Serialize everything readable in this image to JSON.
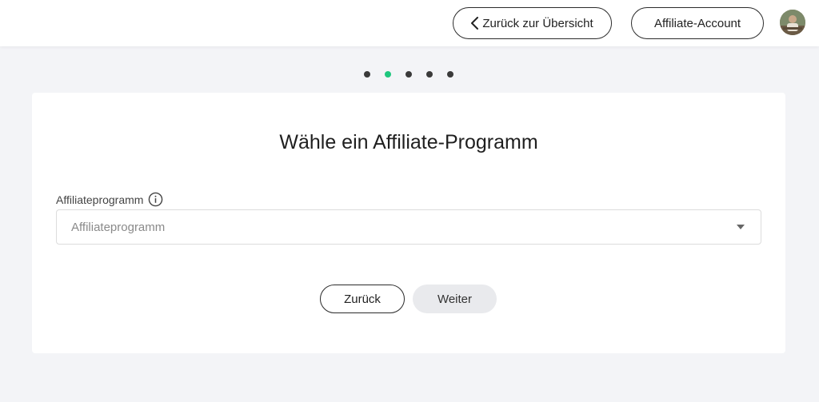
{
  "header": {
    "back_label": "Zurück zur Übersicht",
    "account_label": "Affiliate-Account",
    "avatar_icon": "user-avatar"
  },
  "stepper": {
    "total_steps": 5,
    "current_step": 2,
    "active_color": "#1fc77e",
    "inactive_color": "#3a3a3a"
  },
  "card": {
    "title": "Wähle ein Affiliate-Programm",
    "field": {
      "label": "Affiliateprogramm",
      "info_icon": "info-icon",
      "placeholder": "Affiliateprogramm",
      "value": ""
    },
    "buttons": {
      "back_label": "Zurück",
      "next_label": "Weiter"
    }
  }
}
